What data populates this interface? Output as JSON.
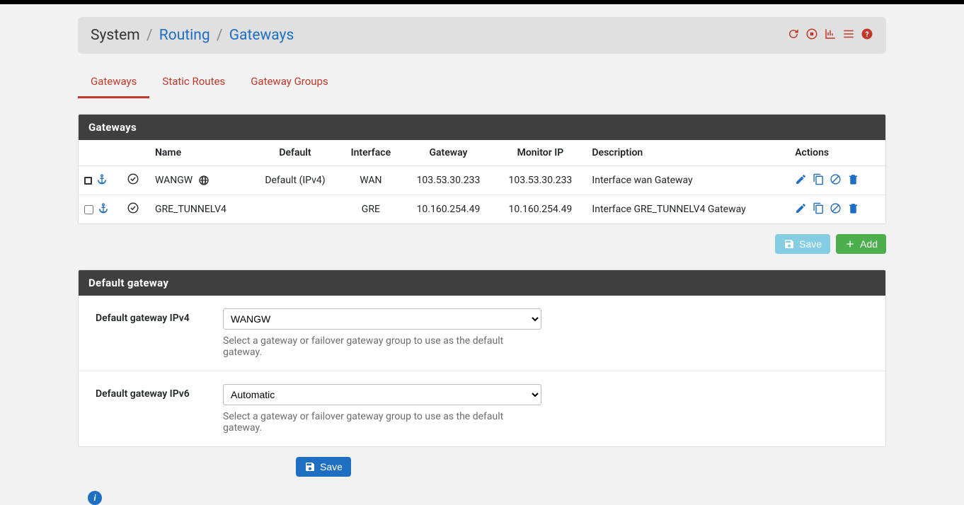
{
  "breadcrumb": {
    "root": "System",
    "mid": "Routing",
    "leaf": "Gateways"
  },
  "tabs": {
    "gateways": "Gateways",
    "static_routes": "Static Routes",
    "gateway_groups": "Gateway Groups"
  },
  "panel1_title": "Gateways",
  "headers": {
    "name": "Name",
    "default": "Default",
    "interface": "Interface",
    "gateway": "Gateway",
    "monitor_ip": "Monitor IP",
    "description": "Description",
    "actions": "Actions"
  },
  "rows": [
    {
      "name": "WANGW",
      "default": "Default (IPv4)",
      "interface": "WAN",
      "gateway": "103.53.30.233",
      "monitor_ip": "103.53.30.233",
      "description": "Interface wan Gateway",
      "is_default": true
    },
    {
      "name": "GRE_TUNNELV4",
      "default": "",
      "interface": "GRE",
      "gateway": "10.160.254.49",
      "monitor_ip": "10.160.254.49",
      "description": "Interface GRE_TUNNELV4 Gateway",
      "is_default": false
    }
  ],
  "buttons": {
    "save": "Save",
    "add": "Add",
    "save2": "Save"
  },
  "panel2_title": "Default gateway",
  "form": {
    "ipv4_label": "Default gateway IPv4",
    "ipv4_value": "WANGW",
    "ipv6_label": "Default gateway IPv6",
    "ipv6_value": "Automatic",
    "help": "Select a gateway or failover gateway group to use as the default gateway."
  }
}
